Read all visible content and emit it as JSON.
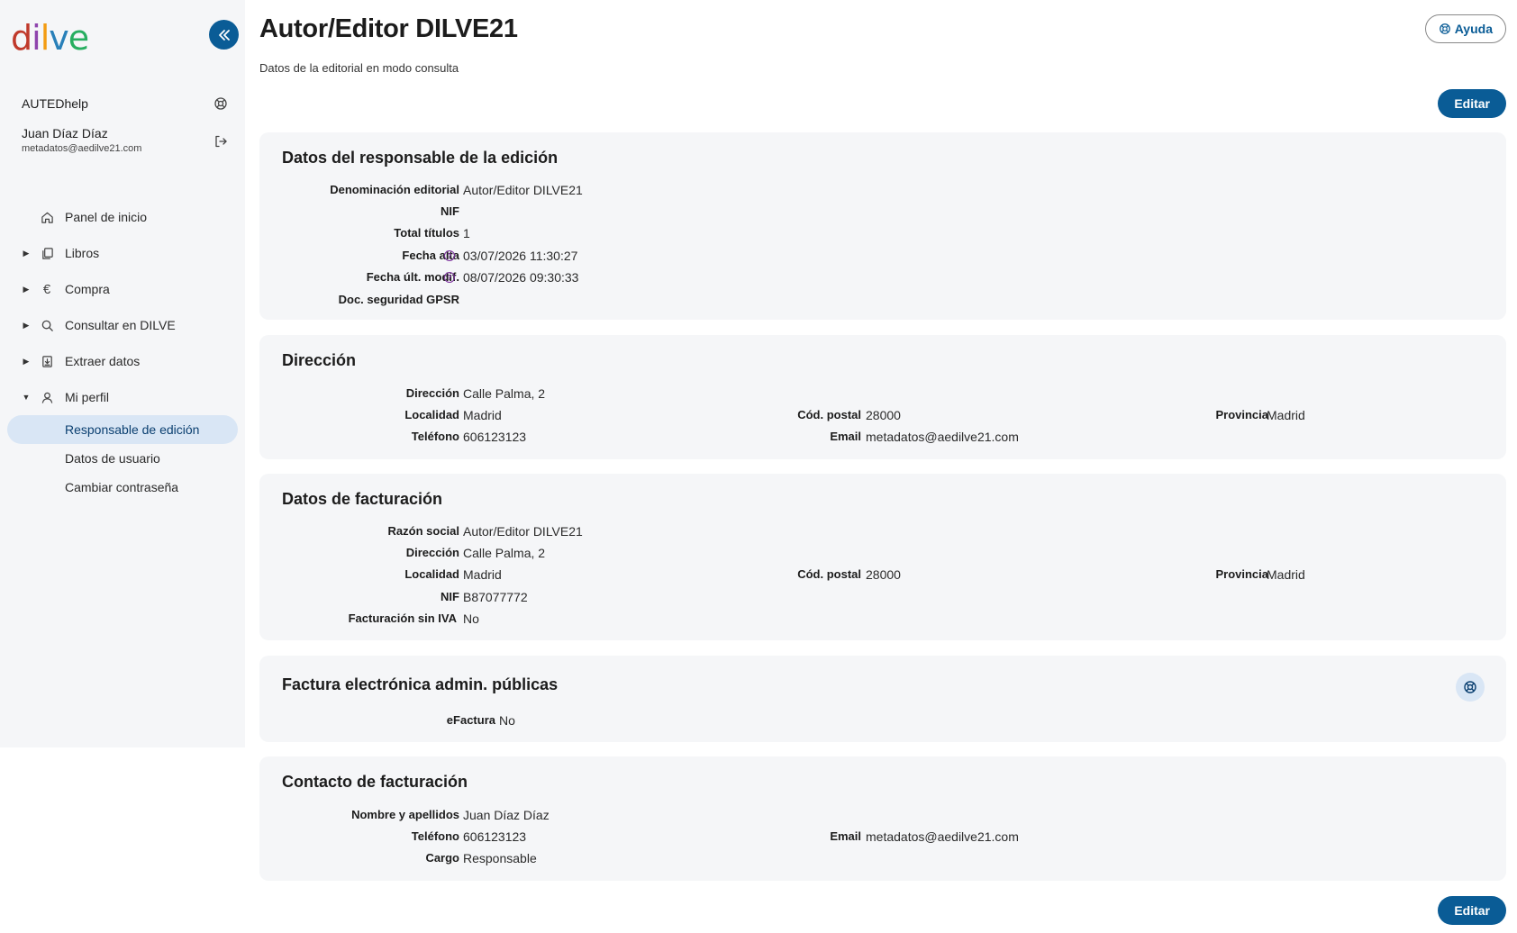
{
  "sidebar": {
    "logo": {
      "d": "d",
      "i": "i",
      "l": "l",
      "v": "v",
      "e": "e"
    },
    "help_label": "AUTEDhelp",
    "user": {
      "name": "Juan Díaz Díaz",
      "email": "metadatos@aedilve21.com"
    },
    "nav": [
      {
        "label": "Panel de inicio"
      },
      {
        "label": "Libros"
      },
      {
        "label": "Compra"
      },
      {
        "label": "Consultar en DILVE"
      },
      {
        "label": "Extraer datos"
      },
      {
        "label": "Mi perfil"
      }
    ],
    "profile_sub": [
      {
        "label": "Responsable de edición"
      },
      {
        "label": "Datos de usuario"
      },
      {
        "label": "Cambiar contraseña"
      }
    ]
  },
  "header": {
    "title": "Autor/Editor DILVE21",
    "subtitle": "Datos de la editorial en modo consulta",
    "help_button": "Ayuda",
    "edit_button": "Editar"
  },
  "responsable": {
    "title": "Datos del responsable de la edición",
    "fields": [
      {
        "label": "Denominación editorial",
        "value": "Autor/Editor DILVE21"
      },
      {
        "label": "NIF",
        "value": ""
      },
      {
        "label": "Total títulos",
        "value": "1"
      },
      {
        "label": "Fecha alta",
        "value": "03/07/2026 11:30:27"
      },
      {
        "label": "Fecha últ. modif.",
        "value": "08/07/2026 09:30:33"
      },
      {
        "label": "Doc. seguridad GPSR",
        "value": ""
      }
    ],
    "help_mark": "?"
  },
  "direccion": {
    "title": "Dirección",
    "direccion_label": "Dirección",
    "direccion_value": "Calle Palma, 2",
    "localidad_label": "Localidad",
    "localidad_value": "Madrid",
    "cp_label": "Cód. postal",
    "cp_value": "28000",
    "provincia_label": "Provincia",
    "provincia_value": "Madrid",
    "telefono_label": "Teléfono",
    "telefono_value": "606123123",
    "email_label": "Email",
    "email_value": "metadatos@aedilve21.com"
  },
  "facturacion": {
    "title": "Datos de facturación",
    "razon_label": "Razón social",
    "razon_value": "Autor/Editor DILVE21",
    "direccion_label": "Dirección",
    "direccion_value": "Calle Palma, 2",
    "localidad_label": "Localidad",
    "localidad_value": "Madrid",
    "cp_label": "Cód. postal",
    "cp_value": "28000",
    "provincia_label": "Provincia",
    "provincia_value": "Madrid",
    "nif_label": "NIF",
    "nif_value": "B87077772",
    "sin_iva_label": "Facturación sin IVA",
    "sin_iva_value": "No"
  },
  "efactura": {
    "title": "Factura electrónica admin. públicas",
    "label": "eFactura",
    "value": "No"
  },
  "contacto": {
    "title": "Contacto de facturación",
    "nombre_label": "Nombre y apellidos",
    "nombre_value": "Juan Díaz Díaz",
    "telefono_label": "Teléfono",
    "telefono_value": "606123123",
    "email_label": "Email",
    "email_value": "metadatos@aedilve21.com",
    "cargo_label": "Cargo",
    "cargo_value": "Responsable"
  },
  "colors": {
    "primary": "#0a5c96",
    "active_bg": "#d9e6f5",
    "card_bg": "#f5f6f8"
  }
}
